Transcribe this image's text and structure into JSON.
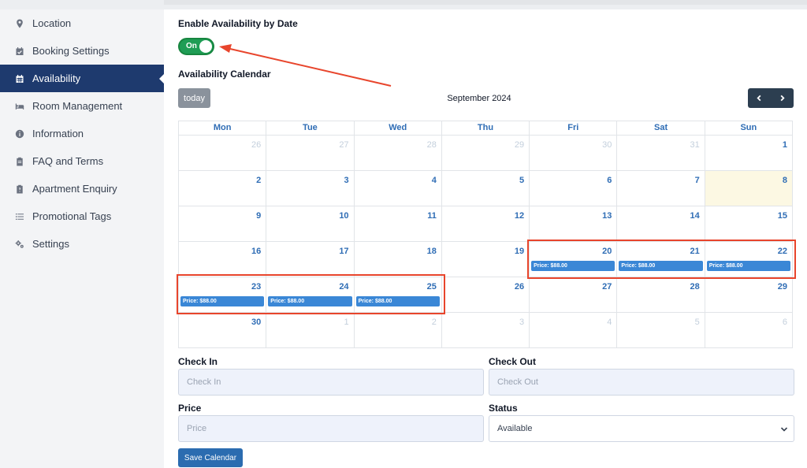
{
  "sidebar": {
    "items": [
      {
        "label": "Location",
        "icon": "map-pin-icon",
        "active": false
      },
      {
        "label": "Booking Settings",
        "icon": "calendar-check-icon",
        "active": false
      },
      {
        "label": "Availability",
        "icon": "calendar-icon",
        "active": true
      },
      {
        "label": "Room Management",
        "icon": "bed-icon",
        "active": false
      },
      {
        "label": "Information",
        "icon": "info-icon",
        "active": false
      },
      {
        "label": "FAQ and Terms",
        "icon": "clipboard-icon",
        "active": false
      },
      {
        "label": "Apartment Enquiry",
        "icon": "clipboard-question-icon",
        "active": false
      },
      {
        "label": "Promotional Tags",
        "icon": "list-icon",
        "active": false
      },
      {
        "label": "Settings",
        "icon": "gears-icon",
        "active": false
      }
    ]
  },
  "availability": {
    "enable_label": "Enable Availability by Date",
    "toggle_label": "On",
    "calendar_label": "Availability Calendar"
  },
  "calendar": {
    "today_label": "today",
    "month_title": "September 2024",
    "weekdays": [
      "Mon",
      "Tue",
      "Wed",
      "Thu",
      "Fri",
      "Sat",
      "Sun"
    ],
    "weeks": [
      [
        {
          "d": "26",
          "o": true
        },
        {
          "d": "27",
          "o": true
        },
        {
          "d": "28",
          "o": true
        },
        {
          "d": "29",
          "o": true
        },
        {
          "d": "30",
          "o": true
        },
        {
          "d": "31",
          "o": true
        },
        {
          "d": "1"
        }
      ],
      [
        {
          "d": "2"
        },
        {
          "d": "3"
        },
        {
          "d": "4"
        },
        {
          "d": "5"
        },
        {
          "d": "6"
        },
        {
          "d": "7"
        },
        {
          "d": "8",
          "today": true
        }
      ],
      [
        {
          "d": "9"
        },
        {
          "d": "10"
        },
        {
          "d": "11"
        },
        {
          "d": "12"
        },
        {
          "d": "13"
        },
        {
          "d": "14"
        },
        {
          "d": "15"
        }
      ],
      [
        {
          "d": "16"
        },
        {
          "d": "17"
        },
        {
          "d": "18"
        },
        {
          "d": "19"
        },
        {
          "d": "20",
          "e": "Price: $88.00"
        },
        {
          "d": "21",
          "e": "Price: $88.00"
        },
        {
          "d": "22",
          "e": "Price: $88.00"
        }
      ],
      [
        {
          "d": "23",
          "e": "Price: $88.00"
        },
        {
          "d": "24",
          "e": "Price: $88.00"
        },
        {
          "d": "25",
          "e": "Price: $88.00"
        },
        {
          "d": "26"
        },
        {
          "d": "27"
        },
        {
          "d": "28"
        },
        {
          "d": "29"
        }
      ],
      [
        {
          "d": "30"
        },
        {
          "d": "1",
          "o": true
        },
        {
          "d": "2",
          "o": true
        },
        {
          "d": "3",
          "o": true
        },
        {
          "d": "4",
          "o": true
        },
        {
          "d": "5",
          "o": true
        },
        {
          "d": "6",
          "o": true
        }
      ]
    ]
  },
  "form": {
    "check_in_label": "Check In",
    "check_in_placeholder": "Check In",
    "check_out_label": "Check Out",
    "check_out_placeholder": "Check Out",
    "price_label": "Price",
    "price_placeholder": "Price",
    "status_label": "Status",
    "status_value": "Available",
    "save_label": "Save Calendar"
  },
  "colors": {
    "sidebar_active": "#1e3a6e",
    "toggle_on": "#1f9d55",
    "event": "#3a87d6",
    "annotation": "#e8452c",
    "today_cell": "#fcf8e3"
  }
}
